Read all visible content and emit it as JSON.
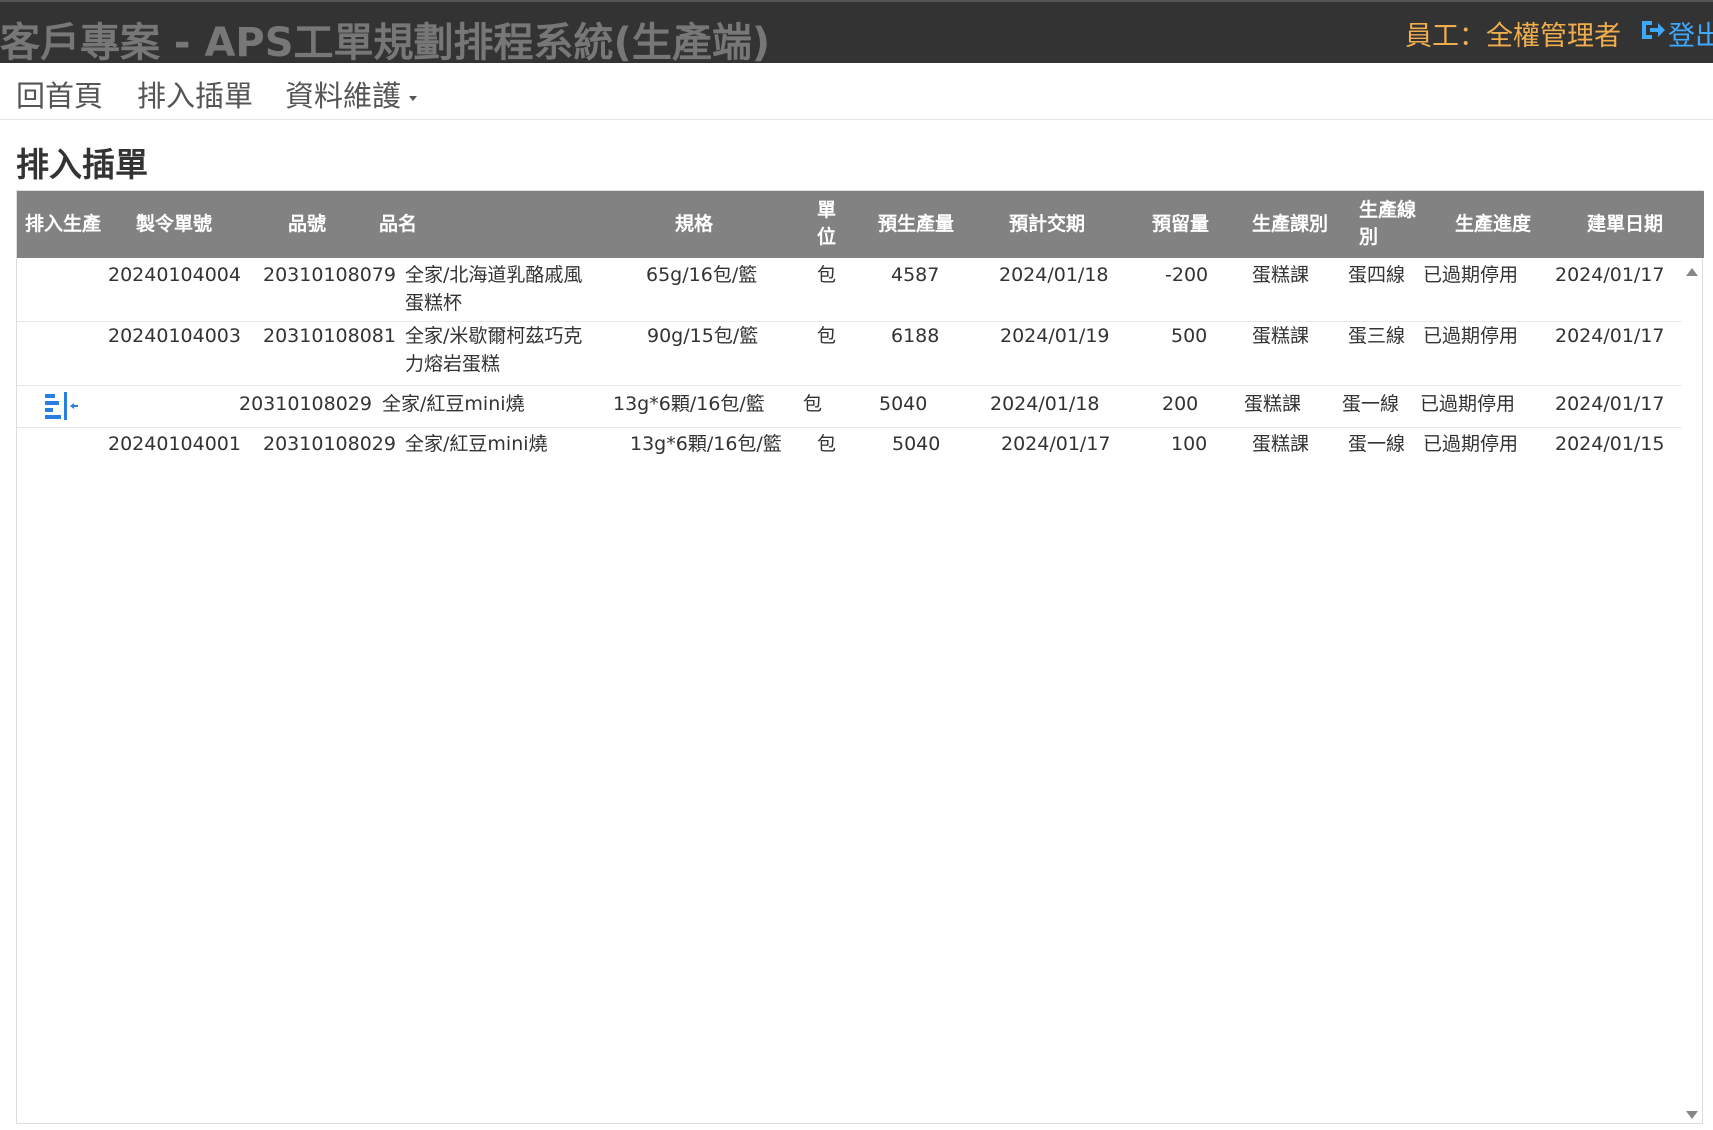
{
  "header": {
    "app_title": "客戶專案 - APS工單規劃排程系統(生產端)",
    "user_label": "員工：全權管理者",
    "logout_label": "登出"
  },
  "nav": {
    "home": "回首頁",
    "insert": "排入插單",
    "maintenance": "資料維護"
  },
  "page": {
    "title": "排入插單"
  },
  "table": {
    "columns": {
      "insert_production": "排入生產",
      "order_no": "製令單號",
      "item_no": "品號",
      "item_name": "品名",
      "spec": "規格",
      "unit": "單位",
      "planned_qty": "預生產量",
      "due_date": "預計交期",
      "reserve_qty": "預留量",
      "section": "生產課別",
      "line": "生產線別",
      "progress": "生產進度",
      "created_date": "建單日期"
    },
    "rows": [
      {
        "order_no": "20240104004",
        "item_no": "20310108079",
        "item_name": "全家/北海道乳酪戚風蛋糕杯",
        "spec": "65g/16包/籃",
        "unit": "包",
        "planned_qty": "4587",
        "due_date": "2024/01/18",
        "reserve_qty": "-200",
        "section": "蛋糕課",
        "line": "蛋四線",
        "progress": "已過期停用",
        "created_date": "2024/01/17"
      },
      {
        "order_no": "20240104003",
        "item_no": "20310108081",
        "item_name": "全家/米歇爾柯茲巧克力熔岩蛋糕",
        "spec": "90g/15包/籃",
        "unit": "包",
        "planned_qty": "6188",
        "due_date": "2024/01/19",
        "reserve_qty": "500",
        "section": "蛋糕課",
        "line": "蛋三線",
        "progress": "已過期停用",
        "created_date": "2024/01/17"
      },
      {
        "insert_icon": "insert-production-icon",
        "order_no": "",
        "item_no": "20310108029",
        "item_name": "全家/紅豆mini燒",
        "spec": "13g*6顆/16包/籃",
        "unit": "包",
        "planned_qty": "5040",
        "due_date": "2024/01/18",
        "reserve_qty": "200",
        "section": "蛋糕課",
        "line": "蛋一線",
        "progress": "已過期停用",
        "created_date": "2024/01/17"
      },
      {
        "order_no": "20240104001",
        "item_no": "20310108029",
        "item_name": "全家/紅豆mini燒",
        "spec": "13g*6顆/16包/籃",
        "unit": "包",
        "planned_qty": "5040",
        "due_date": "2024/01/17",
        "reserve_qty": "100",
        "section": "蛋糕課",
        "line": "蛋一線",
        "progress": "已過期停用",
        "created_date": "2024/01/15"
      }
    ]
  },
  "colors": {
    "topbar_bg": "#333333",
    "title_text": "#777777",
    "user_text": "#f0ad4e",
    "logout_text": "#3ea8ff",
    "table_header_bg": "#828282",
    "insert_icon": "#2a7de1"
  }
}
